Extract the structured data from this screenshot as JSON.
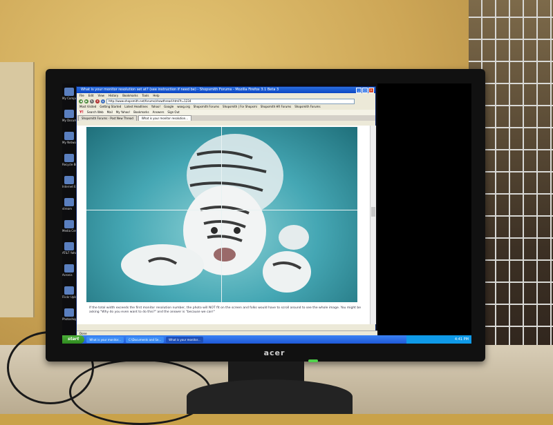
{
  "window": {
    "title": "What is your monitor resolution set at? (see instruction if need be) - Shopsmith Forums - Mozilla Firefox 3.1 Beta 3"
  },
  "menu": [
    "File",
    "Edit",
    "View",
    "History",
    "Bookmarks",
    "Tools",
    "Help"
  ],
  "url": "http://www.shopsmith.net/forums/showthread.html?t=1234",
  "bookmarks": [
    "Most Visited",
    "Getting Started",
    "Latest Headlines",
    "Yahoo!",
    "Google",
    "woog.org",
    "Shopsmith Forums",
    "Shopsmith | For Shopsmi",
    "Shopsmith HR Forums",
    "Shopsmith Forums"
  ],
  "yahoo_toolbar": [
    "Search Web",
    "Mail",
    "My Yahoo!",
    "Bookmarks",
    "Answers",
    "Sign Out"
  ],
  "tabs": [
    "Shopsmith Forums - Post New Thread",
    "What is your monitor resolution..."
  ],
  "content": {
    "body_text": "If the total width exceeds the first monitor resolution number, the photo will NOT fit on the screen and folks would have to scroll around to see the whole image. You might be asking \"Why do you even want to do this?\" and the answer is \"because we can!\""
  },
  "status": "Done",
  "taskbar": {
    "start": "start",
    "buttons": [
      "What is your monitor...",
      "C:\\Documents and Se...",
      "What is your monitor..."
    ],
    "clock": "4:41 PM"
  },
  "desktop_icons": [
    "My Computer",
    "My Documents",
    "My Network Places",
    "Recycle Bin",
    "Internet Explorer",
    "stream",
    "Media Center",
    "AT&T Yahoo!",
    "Acronis",
    "Flickr Uploadr",
    "Photoshop"
  ],
  "monitor_brand": "acer"
}
